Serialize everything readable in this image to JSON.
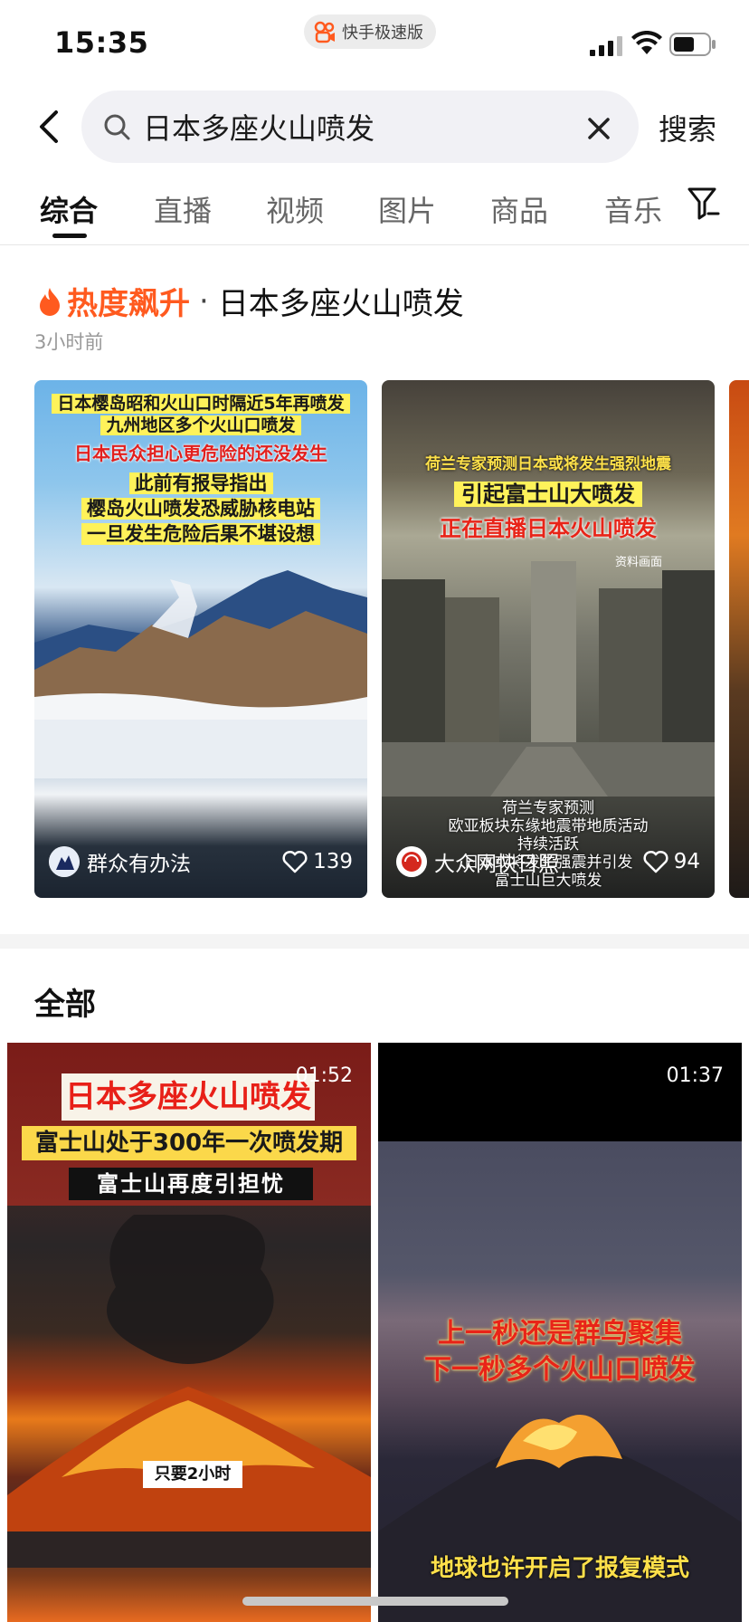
{
  "status_bar": {
    "time": "15:35",
    "app_pill": "快手极速版"
  },
  "search": {
    "query": "日本多座火山喷发",
    "submit_label": "搜索"
  },
  "tabs": [
    "综合",
    "直播",
    "视频",
    "图片",
    "商品",
    "音乐"
  ],
  "hot": {
    "label": "热度飙升",
    "separator": "·",
    "topic": "日本多座火山喷发",
    "time_ago": "3小时前",
    "cards": [
      {
        "lines": [
          "日本樱岛昭和火山口时隔近5年再喷发",
          "九州地区多个火山口喷发",
          "日本民众担心更危险的还没发生",
          "此前有报导指出",
          "樱岛火山喷发恐威胁核电站",
          "一旦发生危险后果不堪设想"
        ],
        "author": "群众有办法",
        "likes": "139"
      },
      {
        "lines": [
          "荷兰专家预测日本或将发生强烈地震",
          "引起富士山大喷发",
          "正在直播日本火山喷发",
          "资料画面"
        ],
        "sub_lines": [
          "荷兰专家预测",
          "欧亚板块东缘地震带地质活动",
          "持续活跃",
          "日本或将发生强震并引发",
          "富士山巨大喷发"
        ],
        "author": "大众网快日照",
        "likes": "94"
      }
    ]
  },
  "all": {
    "title": "全部",
    "videos": [
      {
        "duration": "01:52",
        "lines": [
          "日本多座火山喷发",
          "富士山处于300年一次喷发期",
          "富士山再度引担忧",
          "只要2小时"
        ]
      },
      {
        "duration": "01:37",
        "lines": [
          "上一秒还是群鸟聚集",
          "下一秒多个火山口喷发",
          "地球也许开启了报复模式"
        ]
      }
    ]
  },
  "colors": {
    "hot_accent": "#ff5a1f",
    "highlight_yellow": "#fff25a",
    "alert_red": "#e2201e"
  }
}
